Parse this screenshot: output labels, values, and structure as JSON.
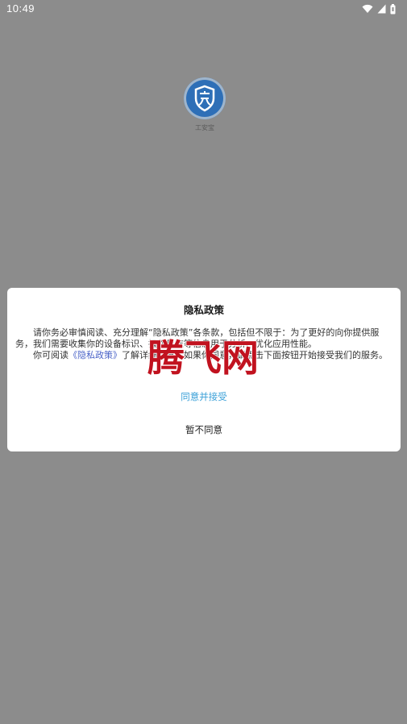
{
  "status_bar": {
    "time": "10:49",
    "icons": [
      "wifi-icon",
      "signal-icon",
      "battery-icon"
    ]
  },
  "app": {
    "logo_icon": "shield-an-icon",
    "name": "工安宝"
  },
  "dialog": {
    "title": "隐私政策",
    "paragraph1": "请你务必审慎阅读、充分理解“隐私政策”各条款，包括但不限于：为了更好的向你提供服务，我们需要收集你的设备标识、操作日志等信息用于分析、优化应用性能。",
    "paragraph2_prefix": "你可阅读",
    "policy_link": "《隐私政策》",
    "paragraph2_suffix": "了解详细信息。如果你同意，请点击下面按钮开始接受我们的服务。",
    "agree_label": "同意并接受",
    "disagree_label": "暂不同意"
  },
  "watermark": {
    "text": "腾飞网",
    "color": "#c1121f"
  },
  "colors": {
    "overlay": "#8c8c8c",
    "link": "#4a63c8",
    "agree": "#3aa0d8",
    "logo": "#2e6fb7"
  }
}
